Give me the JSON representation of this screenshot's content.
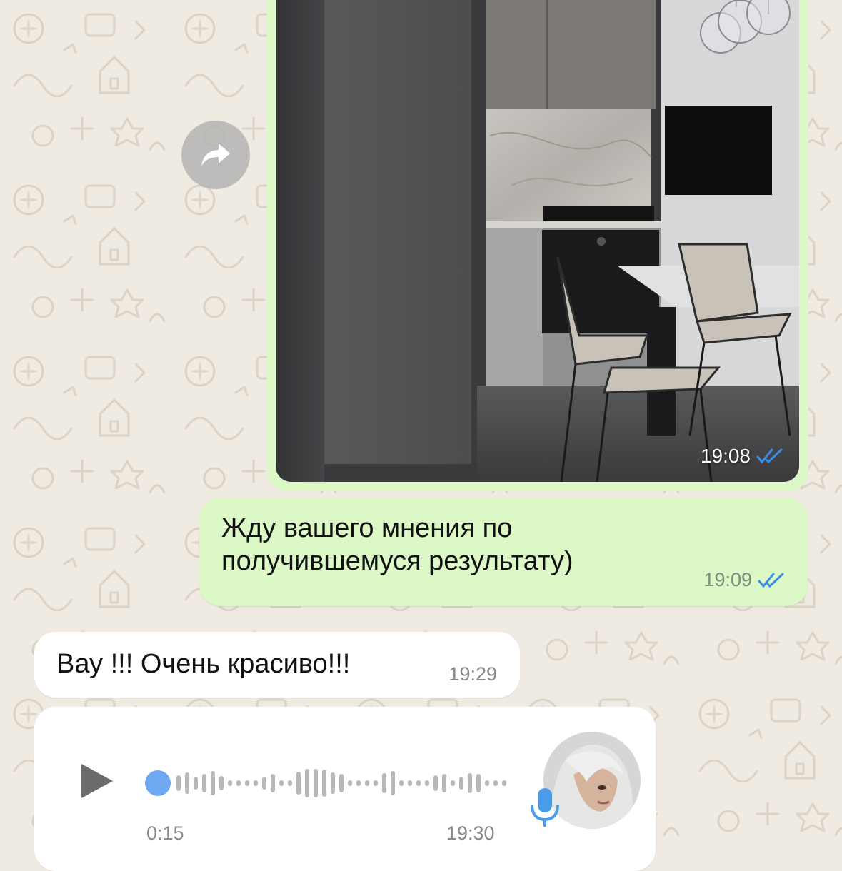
{
  "chat": {
    "image_message": {
      "time": "19:08",
      "status": "read",
      "status_icon": "double-check-icon"
    },
    "forward_icon": "forward-arrow-icon",
    "outgoing_text": {
      "line1": "Жду вашего мнения по",
      "line2": "получившемуся результату)",
      "time": "19:09",
      "status": "read"
    },
    "incoming_text": {
      "text": "Вау !!! Очень красиво!!!",
      "time": "19:29"
    },
    "voice_message": {
      "duration": "0:15",
      "time": "19:30",
      "progress": 0,
      "play_icon": "play-icon",
      "mic_icon": "microphone-icon",
      "avatar_icon": "avatar-icon"
    }
  },
  "colors": {
    "wallpaper": "#efeae2",
    "outgoing_bubble": "#dcf8c6",
    "incoming_bubble": "#ffffff",
    "read_ticks": "#3b8ee8",
    "waveform_dot": "#6ea8f0",
    "waveform_bars": "#b9b9b9",
    "mic": "#4a9be8"
  }
}
